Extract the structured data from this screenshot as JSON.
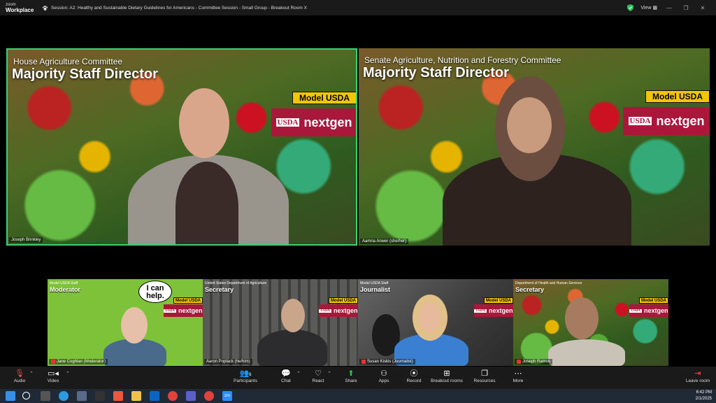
{
  "app": {
    "brand_line1": "zoom",
    "brand_line2": "Workplace",
    "session_title": "Session: A2: Healthy and Sustainable Dietary Guidelines for Americans - Committee Session  - Small Group - Breakout Room X",
    "view_label": "View"
  },
  "colors": {
    "active_speaker": "#3bd16f",
    "model_badge": "#f2c600",
    "nextgen_badge": "#a9173b",
    "leave": "#ff4b4b"
  },
  "badges": {
    "model": "Model USDA",
    "usda": "USDA",
    "nextgen": "nextgen"
  },
  "main_tiles": [
    {
      "caption_small": "House Agriculture Committee",
      "caption_big": "Majority Staff Director",
      "name": "Joseph Brinkley"
    },
    {
      "caption_small": "Senate Agriculture, Nutrition and Forestry Committee",
      "caption_big": "Majority Staff Director",
      "name": "Aamna Anwer (she/her)"
    }
  ],
  "small_tiles": [
    {
      "sub": "Model USDA Staff",
      "role": "Moderator",
      "name": "Jane Coghlan (Moderator)",
      "bubble_line1": "I can",
      "bubble_line2": "help."
    },
    {
      "sub": "United States Department of Agriculture",
      "role": "Secretary",
      "name": "Aaron Poplack (he/him)"
    },
    {
      "sub": "Model USDA Staff",
      "role": "Journalist",
      "name": "Susan Kiskis (Journalist)"
    },
    {
      "sub": "Department of Health and Human Services",
      "role": "Secretary",
      "name": "Joseph Ramos"
    }
  ],
  "toolbar": {
    "audio": "Audio",
    "video": "Video",
    "participants": "Participants",
    "participants_count": "6",
    "chat": "Chat",
    "react": "React",
    "share": "Share",
    "apps": "Apps",
    "record": "Record",
    "breakout": "Breakout rooms",
    "resources": "Resources",
    "more": "More",
    "leave": "Leave room"
  },
  "taskbar": {
    "time": "6:42 PM",
    "date": "2/1/2025",
    "zoom_label": "zm"
  }
}
